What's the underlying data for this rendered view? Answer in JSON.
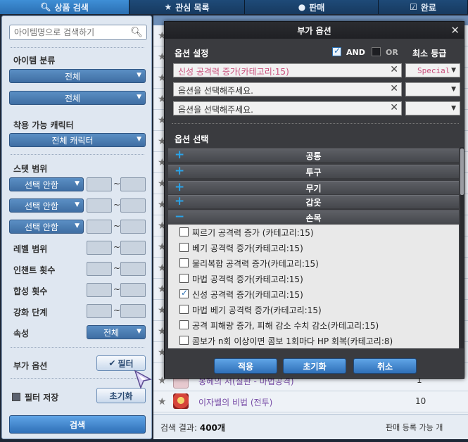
{
  "tabs": [
    {
      "label": "상품 검색",
      "icon": "search-icon"
    },
    {
      "label": "관심 목록",
      "icon": "star-icon"
    },
    {
      "label": "판매",
      "icon": "coin-icon"
    },
    {
      "label": "완료",
      "icon": "check-icon"
    }
  ],
  "filter": {
    "search_placeholder": "아이템명으로 검색하기",
    "item_category_label": "아이템 분류",
    "category_1": "전체",
    "category_2": "전체",
    "character_label": "착용 가능 캐릭터",
    "character_value": "전체 캐릭터",
    "stat_label": "스텟 범위",
    "stat_selects": [
      "선택 안함",
      "선택 안함",
      "선택 안함"
    ],
    "level_label": "레벨 범위",
    "enchant_label": "인챈트 횟수",
    "synthesis_label": "합성 횟수",
    "reinforce_label": "강화 단계",
    "attribute_label": "속성",
    "attribute_value": "전체",
    "extra_option_label": "부가 옵션",
    "filter_button": "필터",
    "save_filter_label": "필터 저장",
    "reset_button": "초기화",
    "search_button": "검색",
    "tilde": "~"
  },
  "results": {
    "count_label": "검색 결과:",
    "count_value": "400개",
    "footer_hint": "판매 등록 가능 개",
    "items": [
      {
        "name": "봉헤의 서(칠판 - 마법공격)",
        "qty": "1",
        "color": "#7a4fa8"
      },
      {
        "name": "이자벨의 비법 (전투)",
        "qty": "10",
        "color": "#7a4fa8"
      }
    ]
  },
  "modal": {
    "title": "부가 옵션",
    "settings_label": "옵션 설정",
    "and_label": "AND",
    "or_label": "OR",
    "min_grade_label": "최소 등급",
    "option_rows": [
      {
        "text": "신성 공격력 증가(카테고리:15)",
        "grade": "Special"
      },
      {
        "text": "옵션을 선택해주세요.",
        "grade": ""
      },
      {
        "text": "옵션을 선택해주세요.",
        "grade": ""
      }
    ],
    "select_label": "옵션 선택",
    "categories": [
      {
        "label": "공통",
        "sign": "+"
      },
      {
        "label": "투구",
        "sign": "+"
      },
      {
        "label": "무기",
        "sign": "+"
      },
      {
        "label": "갑옷",
        "sign": "+"
      },
      {
        "label": "손목",
        "sign": "−"
      }
    ],
    "checklist": [
      {
        "label": "찌르기 공격력 증가 (카테고리:15)",
        "checked": false
      },
      {
        "label": "베기 공격력 증가(카테고리:15)",
        "checked": false
      },
      {
        "label": "물리복합 공격력 증가(카테고리:15)",
        "checked": false
      },
      {
        "label": "마법 공격력 증가(카테고리:15)",
        "checked": false
      },
      {
        "label": "신성 공격력 증가(카테고리:15)",
        "checked": true
      },
      {
        "label": "마법 베기 공격력 증가(카테고리:15)",
        "checked": false
      },
      {
        "label": "공격 피해량 증가, 피해 감소 수치 감소(카테고리:15)",
        "checked": false
      },
      {
        "label": "콤보가 n회 이상이면 콤보 1회마다 HP 회복(카테고리:8)",
        "checked": false
      }
    ],
    "apply_button": "적용",
    "reset_button": "초기화",
    "cancel_button": "취소"
  },
  "colors": {
    "accent_blue": "#2f70b8",
    "special_pink": "#c94f7c"
  }
}
